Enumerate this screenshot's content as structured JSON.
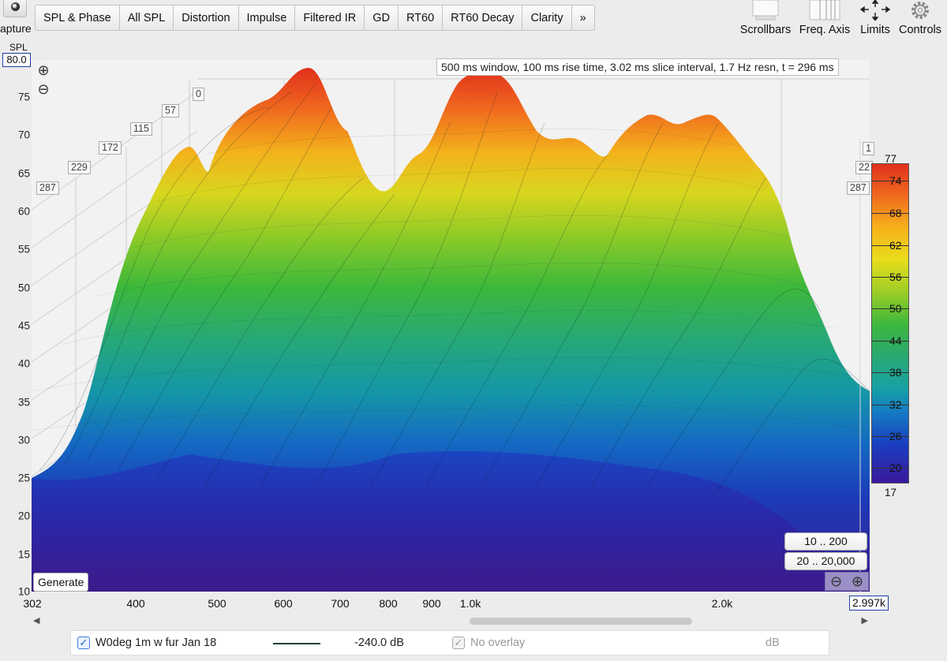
{
  "toolbar": {
    "capture_label": "apture",
    "tabs": [
      {
        "label": "SPL & Phase"
      },
      {
        "label": "All SPL"
      },
      {
        "label": "Distortion"
      },
      {
        "label": "Impulse"
      },
      {
        "label": "Filtered IR"
      },
      {
        "label": "GD"
      },
      {
        "label": "RT60"
      },
      {
        "label": "RT60 Decay"
      },
      {
        "label": "Clarity"
      },
      {
        "label": "»"
      }
    ],
    "tools": [
      {
        "label": "Scrollbars",
        "icon": "scrollbars-icon"
      },
      {
        "label": "Freq. Axis",
        "icon": "freq-axis-icon"
      },
      {
        "label": "Limits",
        "icon": "limits-icon"
      },
      {
        "label": "Controls",
        "icon": "gear-icon"
      }
    ]
  },
  "plot": {
    "y_axis_label": "SPL",
    "y_max": "80.0",
    "y_ticks": [
      "75",
      "70",
      "65",
      "60",
      "55",
      "50",
      "45",
      "40",
      "35",
      "30",
      "25",
      "20",
      "15",
      "10"
    ],
    "info": "500 ms window, 100 ms rise time, 3.02 ms slice interval, 1.7 Hz resn, t = 296 ms",
    "time_labels_left": [
      "287",
      "229",
      "172",
      "115",
      "57",
      "0"
    ],
    "time_labels_right": [
      "1",
      "22",
      "287"
    ],
    "x_min": "302",
    "x_ticks": [
      "400",
      "500",
      "600",
      "700",
      "800",
      "900",
      "1.0k",
      "2.0k"
    ],
    "x_max": "2.997k",
    "generate_label": "Generate",
    "range_buttons": [
      "10 .. 200",
      "20 .. 20,000"
    ],
    "colorbar": {
      "max": "77",
      "min": "17",
      "labels": [
        "74",
        "68",
        "62",
        "56",
        "50",
        "44",
        "38",
        "32",
        "26",
        "20"
      ],
      "colors": [
        "#e0301c",
        "#f06a1e",
        "#f6b21b",
        "#e9dc1c",
        "#9ecf26",
        "#3fb83b",
        "#2aa870",
        "#17a2a3",
        "#157ac4",
        "#1a3ec1",
        "#3a189c"
      ]
    }
  },
  "legend": {
    "measurement_name": "W0deg 1m w fur Jan 18",
    "level": "-240.0 dB",
    "overlay_label": "No overlay",
    "unit": "dB"
  }
}
